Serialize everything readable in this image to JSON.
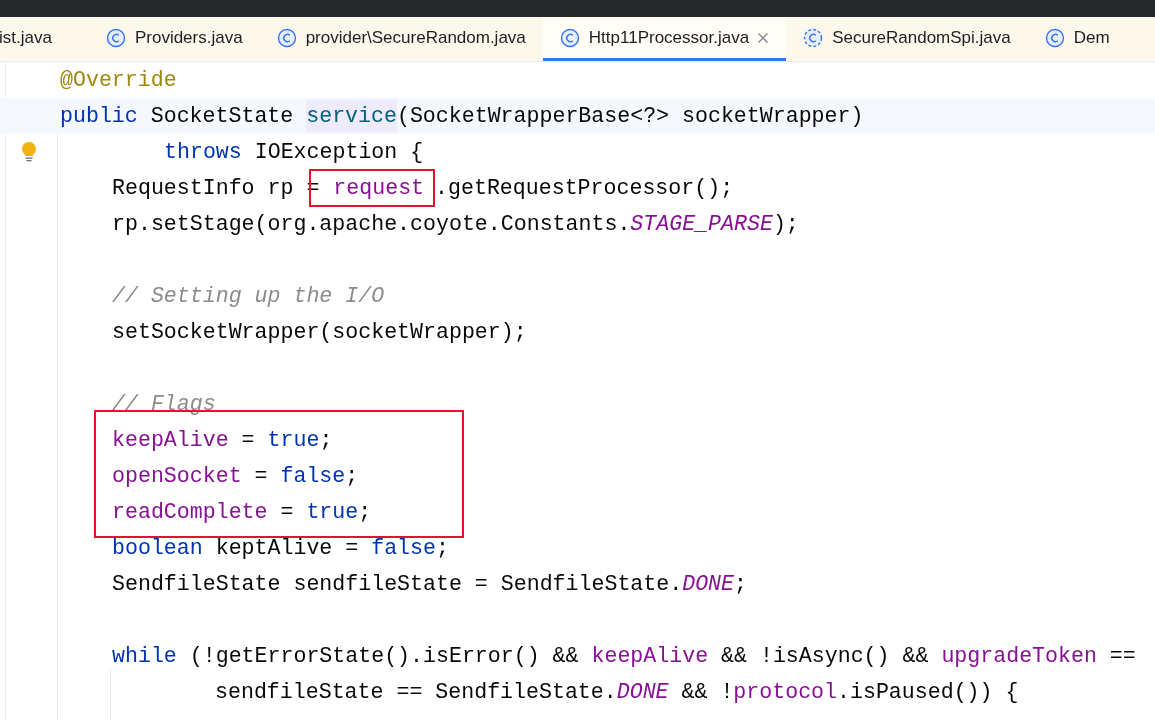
{
  "tabs": [
    {
      "label": "ist.java",
      "kind": "plain",
      "selected": false,
      "closable": false
    },
    {
      "label": "Providers.java",
      "kind": "class",
      "selected": false,
      "closable": false
    },
    {
      "label": "provider\\SecureRandom.java",
      "kind": "class",
      "selected": false,
      "closable": false
    },
    {
      "label": "Http11Processor.java",
      "kind": "class",
      "selected": true,
      "closable": true
    },
    {
      "label": "SecureRandomSpi.java",
      "kind": "abstract",
      "selected": false,
      "closable": false
    },
    {
      "label": "Dem",
      "kind": "class",
      "selected": false,
      "closable": false
    }
  ],
  "editor": {
    "lines": [
      {
        "kind": "member",
        "tokens": [
          {
            "t": "@Override",
            "kind": "annotation"
          }
        ]
      },
      {
        "kind": "member",
        "current": true,
        "tokens": [
          {
            "t": "public",
            "kind": "keyword"
          },
          {
            "t": " SocketState ",
            "kind": "plain"
          },
          {
            "t": "service",
            "kind": "method-decl"
          },
          {
            "t": "(SocketWrapperBase<?> socketWrapper)",
            "kind": "plain"
          }
        ]
      },
      {
        "kind": "wrapped",
        "bulb": true,
        "tokens": [
          {
            "t": "throws",
            "kind": "keyword"
          },
          {
            "t": " IOException {",
            "kind": "plain"
          }
        ]
      },
      {
        "kind": "body",
        "tokens": [
          {
            "t": "RequestInfo rp =",
            "kind": "plain"
          },
          {
            "t": "request",
            "kind": "field",
            "boxed": true
          },
          {
            "t": ".getRequestProcessor();",
            "kind": "plain"
          }
        ]
      },
      {
        "kind": "body",
        "tokens": [
          {
            "t": "rp.setStage(org.apache.coyote.Constants.",
            "kind": "plain"
          },
          {
            "t": "STAGE_PARSE",
            "kind": "constant"
          },
          {
            "t": ");",
            "kind": "plain"
          }
        ]
      },
      {
        "kind": "blank"
      },
      {
        "kind": "body",
        "tokens": [
          {
            "t": "// Setting up the I/O",
            "kind": "comment"
          }
        ]
      },
      {
        "kind": "body",
        "tokens": [
          {
            "t": "setSocketWrapper(socketWrapper);",
            "kind": "plain"
          }
        ]
      },
      {
        "kind": "blank"
      },
      {
        "kind": "body",
        "tokens": [
          {
            "t": "// Flags",
            "kind": "comment"
          }
        ]
      },
      {
        "kind": "body",
        "tokens": [
          {
            "t": "keepAlive",
            "kind": "field"
          },
          {
            "t": " = ",
            "kind": "plain"
          },
          {
            "t": "true",
            "kind": "keyword"
          },
          {
            "t": ";",
            "kind": "plain"
          }
        ]
      },
      {
        "kind": "body",
        "tokens": [
          {
            "t": "openSocket",
            "kind": "field"
          },
          {
            "t": " = ",
            "kind": "plain"
          },
          {
            "t": "false",
            "kind": "keyword"
          },
          {
            "t": ";",
            "kind": "plain"
          }
        ]
      },
      {
        "kind": "body",
        "tokens": [
          {
            "t": "readComplete",
            "kind": "field"
          },
          {
            "t": " = ",
            "kind": "plain"
          },
          {
            "t": "true",
            "kind": "keyword"
          },
          {
            "t": ";",
            "kind": "plain"
          }
        ]
      },
      {
        "kind": "body",
        "tokens": [
          {
            "t": "boolean",
            "kind": "keyword"
          },
          {
            "t": " keptAlive = ",
            "kind": "plain"
          },
          {
            "t": "false",
            "kind": "keyword"
          },
          {
            "t": ";",
            "kind": "plain"
          }
        ]
      },
      {
        "kind": "body",
        "tokens": [
          {
            "t": "SendfileState sendfileState = SendfileState.",
            "kind": "plain"
          },
          {
            "t": "DONE",
            "kind": "constant"
          },
          {
            "t": ";",
            "kind": "plain"
          }
        ]
      },
      {
        "kind": "blank"
      },
      {
        "kind": "body",
        "tokens": [
          {
            "t": "while",
            "kind": "keyword"
          },
          {
            "t": " (!getErrorState().isError() && ",
            "kind": "plain"
          },
          {
            "t": "keepAlive",
            "kind": "field"
          },
          {
            "t": " && !isAsync() && ",
            "kind": "plain"
          },
          {
            "t": "upgradeToken",
            "kind": "field"
          },
          {
            "t": " ==",
            "kind": "plain"
          }
        ]
      },
      {
        "kind": "continuation",
        "tokens": [
          {
            "t": "sendfileState == SendfileState.",
            "kind": "plain"
          },
          {
            "t": "DONE",
            "kind": "constant"
          },
          {
            "t": " && !",
            "kind": "plain"
          },
          {
            "t": "protocol",
            "kind": "field"
          },
          {
            "t": ".isPaused()) {",
            "kind": "plain"
          }
        ]
      }
    ]
  }
}
